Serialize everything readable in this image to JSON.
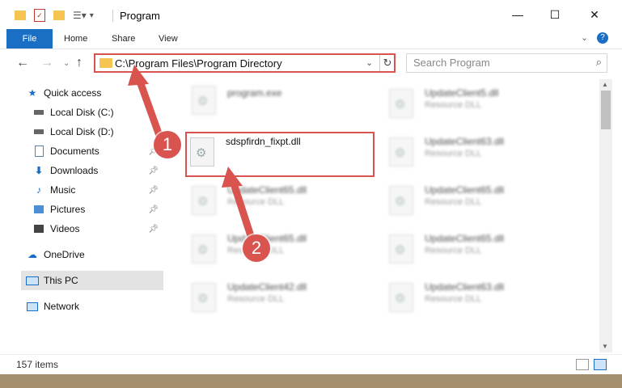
{
  "window": {
    "title": "Program",
    "controls": [
      "minimize-icon",
      "maximize-icon",
      "close-icon"
    ]
  },
  "ribbon": {
    "tabs": [
      {
        "label": "File"
      },
      {
        "label": "Home"
      },
      {
        "label": "Share"
      },
      {
        "label": "View"
      }
    ]
  },
  "nav": {
    "address": "C:\\Program Files\\Program Directory",
    "search_placeholder": "Search Program"
  },
  "sidebar": {
    "items": [
      {
        "label": "Quick access",
        "icon": "star-icon",
        "pinned": false
      },
      {
        "label": "Local Disk (C:)",
        "icon": "drive-icon",
        "pinned": false
      },
      {
        "label": "Local Disk (D:)",
        "icon": "drive-icon",
        "pinned": false
      },
      {
        "label": "Documents",
        "icon": "documents-icon",
        "pinned": true
      },
      {
        "label": "Downloads",
        "icon": "download-icon",
        "pinned": true
      },
      {
        "label": "Music",
        "icon": "music-icon",
        "pinned": true
      },
      {
        "label": "Pictures",
        "icon": "pictures-icon",
        "pinned": true
      },
      {
        "label": "Videos",
        "icon": "videos-icon",
        "pinned": true
      },
      {
        "label": "OneDrive",
        "icon": "cloud-icon",
        "pinned": false
      },
      {
        "label": "This PC",
        "icon": "computer-icon",
        "pinned": false,
        "selected": true
      },
      {
        "label": "Network",
        "icon": "network-icon",
        "pinned": false
      }
    ]
  },
  "files": {
    "left": [
      {
        "name": "program.exe",
        "type": ""
      },
      {
        "name": "sdspfirdn_fixpt.dll",
        "type": ""
      },
      {
        "name": "UpdateClient65.dll",
        "type": "Resource DLL"
      },
      {
        "name": "UpdateClient65.dll",
        "type": "Resource DLL"
      },
      {
        "name": "UpdateClient42.dll",
        "type": "Resource DLL"
      }
    ],
    "right": [
      {
        "name": "UpdateClient5.dll",
        "type": "Resource DLL"
      },
      {
        "name": "UpdateClient63.dll",
        "type": "Resource DLL"
      },
      {
        "name": "UpdateClient65.dll",
        "type": "Resource DLL"
      },
      {
        "name": "UpdateClient65.dll",
        "type": "Resource DLL"
      },
      {
        "name": "UpdateClient63.dll",
        "type": "Resource DLL"
      }
    ]
  },
  "status": {
    "count": "157 items"
  },
  "annotations": {
    "badge1": "1",
    "badge2": "2"
  },
  "colors": {
    "accent": "#1a6fc4",
    "highlight": "#d9534f"
  }
}
